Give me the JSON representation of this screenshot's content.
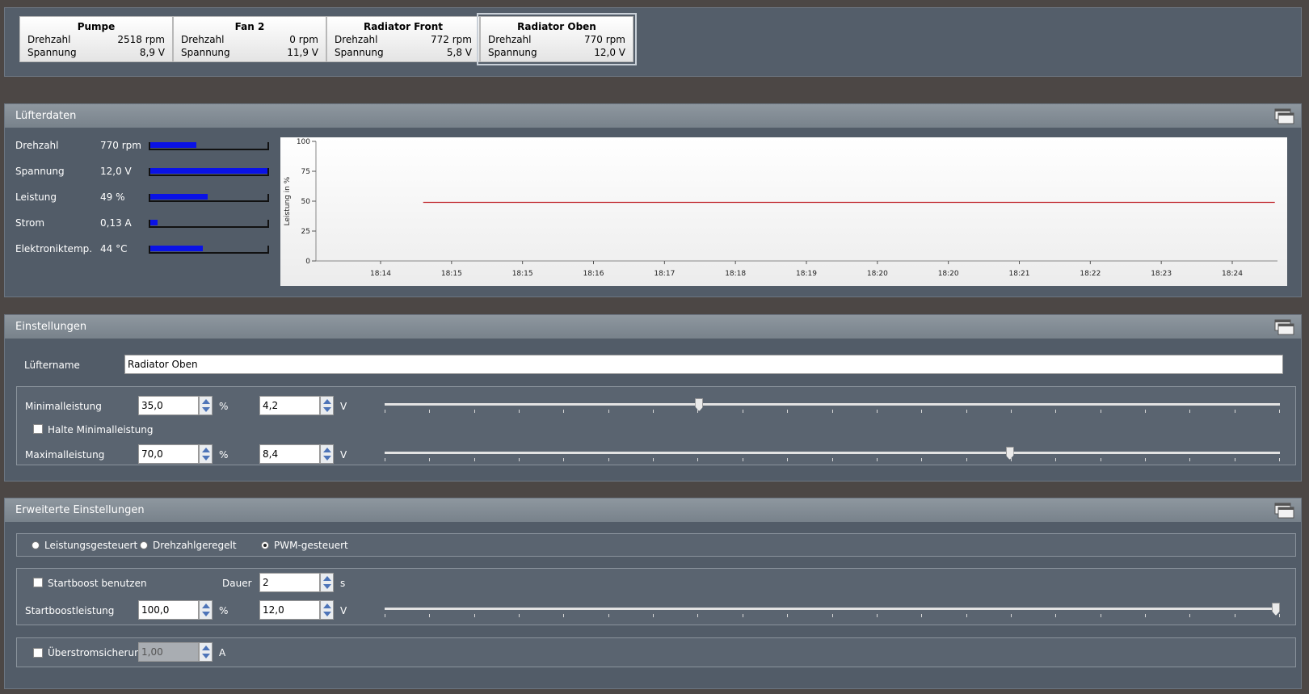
{
  "fans": [
    {
      "name": "Pumpe",
      "rpm_label": "Drehzahl",
      "rpm": "2518 rpm",
      "voltage_label": "Spannung",
      "voltage": "8,9 V",
      "selected": false
    },
    {
      "name": "Fan 2",
      "rpm_label": "Drehzahl",
      "rpm": "0 rpm",
      "voltage_label": "Spannung",
      "voltage": "11,9 V",
      "selected": false
    },
    {
      "name": "Radiator Front",
      "rpm_label": "Drehzahl",
      "rpm": "772 rpm",
      "voltage_label": "Spannung",
      "voltage": "5,8 V",
      "selected": false
    },
    {
      "name": "Radiator Oben",
      "rpm_label": "Drehzahl",
      "rpm": "770 rpm",
      "voltage_label": "Spannung",
      "voltage": "12,0 V",
      "selected": true
    }
  ],
  "fan_data": {
    "title": "Lüfterdaten",
    "stats": [
      {
        "label": "Drehzahl",
        "value": "770 rpm",
        "fill_fraction": 0.39
      },
      {
        "label": "Spannung",
        "value": "12,0 V",
        "fill_fraction": 1.0
      },
      {
        "label": "Leistung",
        "value": "49 %",
        "fill_fraction": 0.49
      },
      {
        "label": "Strom",
        "value": "0,13 A",
        "fill_fraction": 0.06
      },
      {
        "label": "Elektroniktemp.",
        "value": "44 °C",
        "fill_fraction": 0.45
      }
    ]
  },
  "chart_data": {
    "type": "line",
    "title": "",
    "xlabel": "",
    "ylabel": "Leistung in %",
    "ylim": [
      0,
      100
    ],
    "y_ticks": [
      0,
      25,
      50,
      75,
      100
    ],
    "x_tick_labels": [
      "18:14",
      "18:15",
      "18:15",
      "18:16",
      "18:17",
      "18:18",
      "18:19",
      "18:20",
      "18:20",
      "18:21",
      "18:22",
      "18:23",
      "18:24"
    ],
    "x": [
      0.6,
      12.6
    ],
    "series": [
      {
        "values": [
          49,
          49
        ],
        "color": "#c0272d"
      }
    ],
    "grid": false,
    "legend": "none"
  },
  "settings": {
    "title": "Einstellungen",
    "fan_name_label": "Lüftername",
    "fan_name": "Radiator Oben",
    "min_label": "Minimalleistung",
    "min_percent": "35,0",
    "min_volt": "4,2",
    "percent_unit": "%",
    "volt_unit": "V",
    "hold_min_label": "Halte Minimalleistung",
    "hold_min_checked": false,
    "max_label": "Maximalleistung",
    "max_percent": "70,0",
    "max_volt": "8,4",
    "min_slider_fraction": 0.35,
    "max_slider_fraction": 0.7
  },
  "advanced": {
    "title": "Erweiterte Einstellungen",
    "modes": [
      {
        "label": "Leistungsgesteuert",
        "checked": false
      },
      {
        "label": "Drehzahlgeregelt",
        "checked": false
      },
      {
        "label": "PWM-gesteuert",
        "checked": true
      }
    ],
    "startboost_label": "Startboost benutzen",
    "startboost_checked": false,
    "duration_label": "Dauer",
    "duration": "2",
    "duration_unit": "s",
    "boost_power_label": "Startboostleistung",
    "boost_percent": "100,0",
    "boost_volt": "12,0",
    "percent_unit": "%",
    "volt_unit": "V",
    "boost_slider_fraction": 1.0,
    "overcurrent_label": "Überstromsicherung",
    "overcurrent_checked": false,
    "overcurrent_value": "1,00",
    "overcurrent_unit": "A"
  },
  "colors": {
    "bar_fill": "#0a12e6",
    "chart_line": "#c0272d",
    "panel": "#525c68"
  }
}
